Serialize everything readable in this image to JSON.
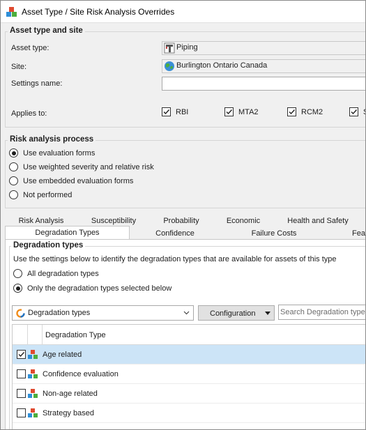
{
  "window": {
    "title": "Asset Type / Site Risk Analysis Overrides"
  },
  "asset_group": {
    "title": "Asset type and site",
    "asset_type_label": "Asset type:",
    "asset_type_value": "Piping",
    "site_label": "Site:",
    "site_value": "Burlington Ontario Canada",
    "settings_name_label": "Settings name:",
    "settings_name_value": "",
    "applies_to_label": "Applies to:",
    "applies": [
      {
        "label": "RBI",
        "checked": true
      },
      {
        "label": "MTA2",
        "checked": true
      },
      {
        "label": "RCM2",
        "checked": true
      },
      {
        "label": "S",
        "checked": true
      }
    ]
  },
  "risk_process": {
    "title": "Risk analysis process",
    "options": [
      {
        "label": "Use evaluation forms",
        "selected": true
      },
      {
        "label": "Use weighted severity and relative risk",
        "selected": false
      },
      {
        "label": "Use embedded evaluation forms",
        "selected": false
      },
      {
        "label": "Not performed",
        "selected": false
      }
    ]
  },
  "tabs": {
    "row1": [
      "Risk Analysis",
      "Susceptibility",
      "Probability",
      "Economic",
      "Health and Safety"
    ],
    "row2": [
      "Degradation Types",
      "Confidence",
      "Failure Costs",
      "Fea"
    ],
    "selected": "Degradation Types"
  },
  "degradation": {
    "title": "Degradation types",
    "description": "Use the settings below to identify the degradation types that are available for assets of this type",
    "options": [
      {
        "label": "All degradation types",
        "selected": false
      },
      {
        "label": "Only the degradation types selected below",
        "selected": true
      }
    ],
    "combo_value": "Degradation types",
    "config_button": "Configuration",
    "search_placeholder": "Search Degradation types",
    "column_header": "Degradation Type",
    "rows": [
      {
        "name": "Age related",
        "checked": true,
        "selected": true
      },
      {
        "name": "Confidence evaluation",
        "checked": false,
        "selected": false
      },
      {
        "name": "Non-age related",
        "checked": false,
        "selected": false
      },
      {
        "name": "Strategy based",
        "checked": false,
        "selected": false
      }
    ]
  },
  "colors": {
    "selection": "#cce4f7",
    "panel": "#f0f0f0",
    "accent_blue": "#1e73c8"
  }
}
